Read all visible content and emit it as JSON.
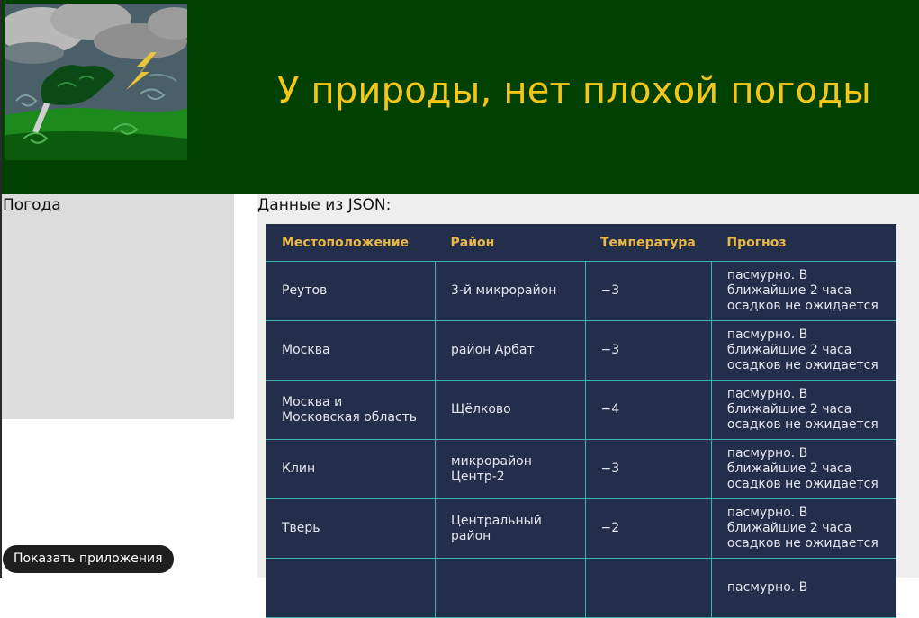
{
  "header": {
    "title": "У природы, нет плохой погоды",
    "logo_icon": "storm-weather-logo-icon"
  },
  "sidebar": {
    "title": "Погода"
  },
  "main": {
    "heading": "Данные из JSON:",
    "table": {
      "columns": [
        "Местоположение",
        "Район",
        "Температура",
        "Прогноз"
      ],
      "rows": [
        {
          "location": "Реутов",
          "district": "3-й микрорайон",
          "temperature": "−3",
          "forecast": "пасмурно. В ближайшие 2 часа осадков не ожидается"
        },
        {
          "location": "Москва",
          "district": "район Арбат",
          "temperature": "−3",
          "forecast": "пасмурно. В ближайшие 2 часа осадков не ожидается"
        },
        {
          "location": "Москва и Московская область",
          "district": "Щёлково",
          "temperature": "−4",
          "forecast": "пасмурно. В ближайшие 2 часа осадков не ожидается"
        },
        {
          "location": "Клин",
          "district": "микрорайон Центр-2",
          "temperature": "−3",
          "forecast": "пасмурно. В ближайшие 2 часа осадков не ожидается"
        },
        {
          "location": "Тверь",
          "district": "Центральный район",
          "temperature": "−2",
          "forecast": "пасмурно. В ближайшие 2 часа осадков не ожидается"
        },
        {
          "location": "",
          "district": "",
          "temperature": "",
          "forecast": "пасмурно. В"
        }
      ]
    }
  },
  "taskbar": {
    "show_apps_label": "Показать приложения"
  },
  "colors": {
    "header_bg": "#004000",
    "title_color": "#f5c518",
    "table_bg": "#232e4b",
    "table_header_text": "#e8b84a",
    "table_border": "#3fb2aa",
    "sidebar_bg": "#dcdcdc",
    "main_bg": "#eeeeee"
  }
}
